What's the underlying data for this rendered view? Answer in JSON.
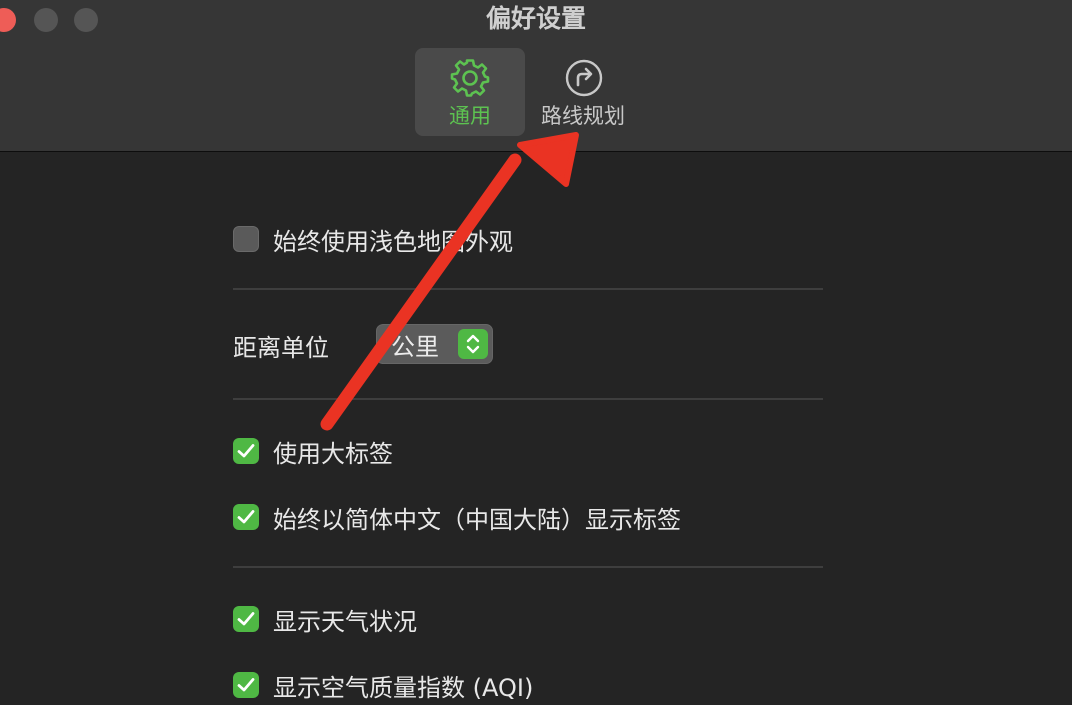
{
  "window": {
    "title": "偏好设置"
  },
  "tabs": [
    {
      "label": "通用",
      "icon": "gear-icon",
      "selected": true
    },
    {
      "label": "路线规划",
      "icon": "route-arrow-icon",
      "selected": false
    }
  ],
  "settings": {
    "light_map": {
      "label": "始终使用浅色地图外观",
      "checked": false
    },
    "distance_unit": {
      "label": "距离单位",
      "value": "公里"
    },
    "large_labels": {
      "label": "使用大标签",
      "checked": true
    },
    "simplified_chinese": {
      "label": "始终以简体中文（中国大陆）显示标签",
      "checked": true
    },
    "weather": {
      "label": "显示天气状况",
      "checked": true
    },
    "aqi": {
      "label": "显示空气质量指数 (AQI)",
      "checked": true
    }
  },
  "colors": {
    "accent": "#4fb844",
    "annotation_arrow": "#ea3323",
    "close_light": "#ee5d57"
  }
}
